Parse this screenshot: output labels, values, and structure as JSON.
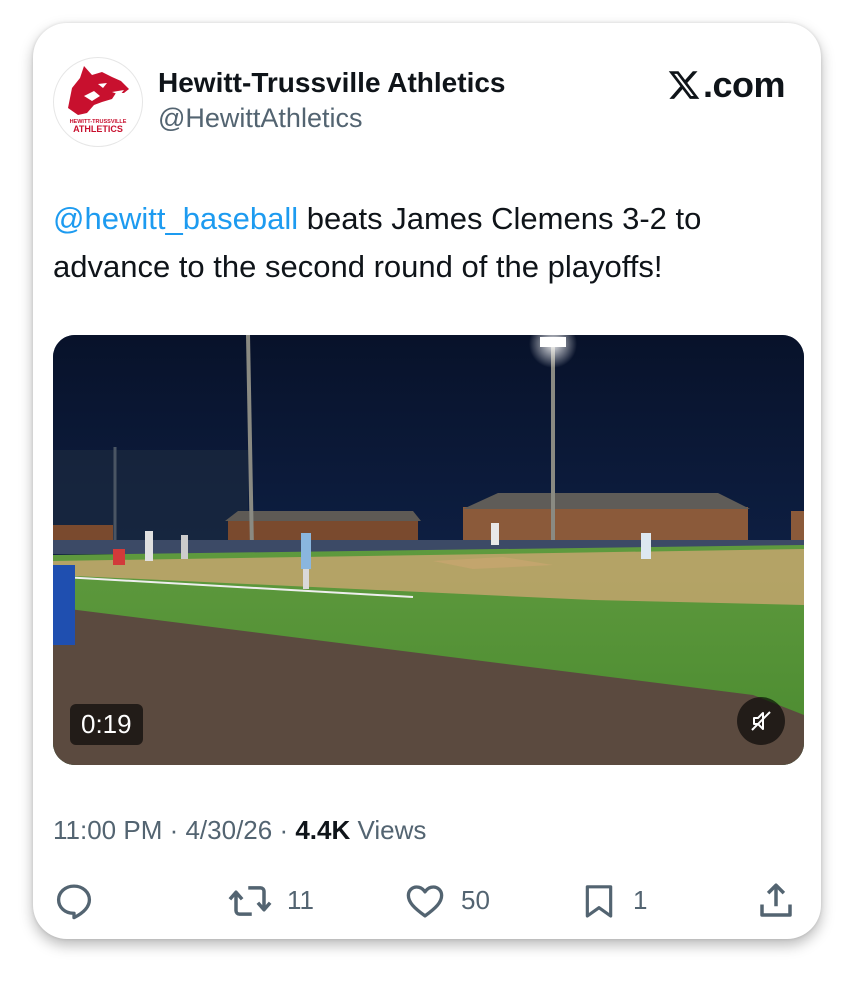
{
  "account": {
    "display_name": "Hewitt-Trussville Athletics",
    "handle": "@HewittAthletics",
    "avatar_icon": "husky-logo",
    "avatar_text_1": "HEWITT-TRUSSVILLE",
    "avatar_text_2": "ATHLETICS"
  },
  "brand": {
    "label": ".com",
    "icon": "x-logo-icon"
  },
  "tweet": {
    "mention": "@hewitt_baseball",
    "text": " beats James Clemens 3-2 to advance to the second round of the playoffs!"
  },
  "video": {
    "duration": "0:19",
    "mute_icon": "speaker-muted-icon"
  },
  "meta": {
    "time": "11:00 PM",
    "sep1": " · ",
    "date": "4/30/26",
    "sep2": " · ",
    "views_count": "4.4K",
    "views_label": " Views"
  },
  "actions": {
    "reply": {
      "icon": "reply-icon",
      "count": ""
    },
    "retweet": {
      "icon": "retweet-icon",
      "count": "11"
    },
    "like": {
      "icon": "heart-icon",
      "count": "50"
    },
    "bookmark": {
      "icon": "bookmark-icon",
      "count": "1"
    },
    "share": {
      "icon": "share-icon"
    }
  },
  "colors": {
    "link": "#1d9bf0",
    "text": "#0f1419",
    "secondary": "#536471",
    "logo_red": "#c8102e"
  }
}
